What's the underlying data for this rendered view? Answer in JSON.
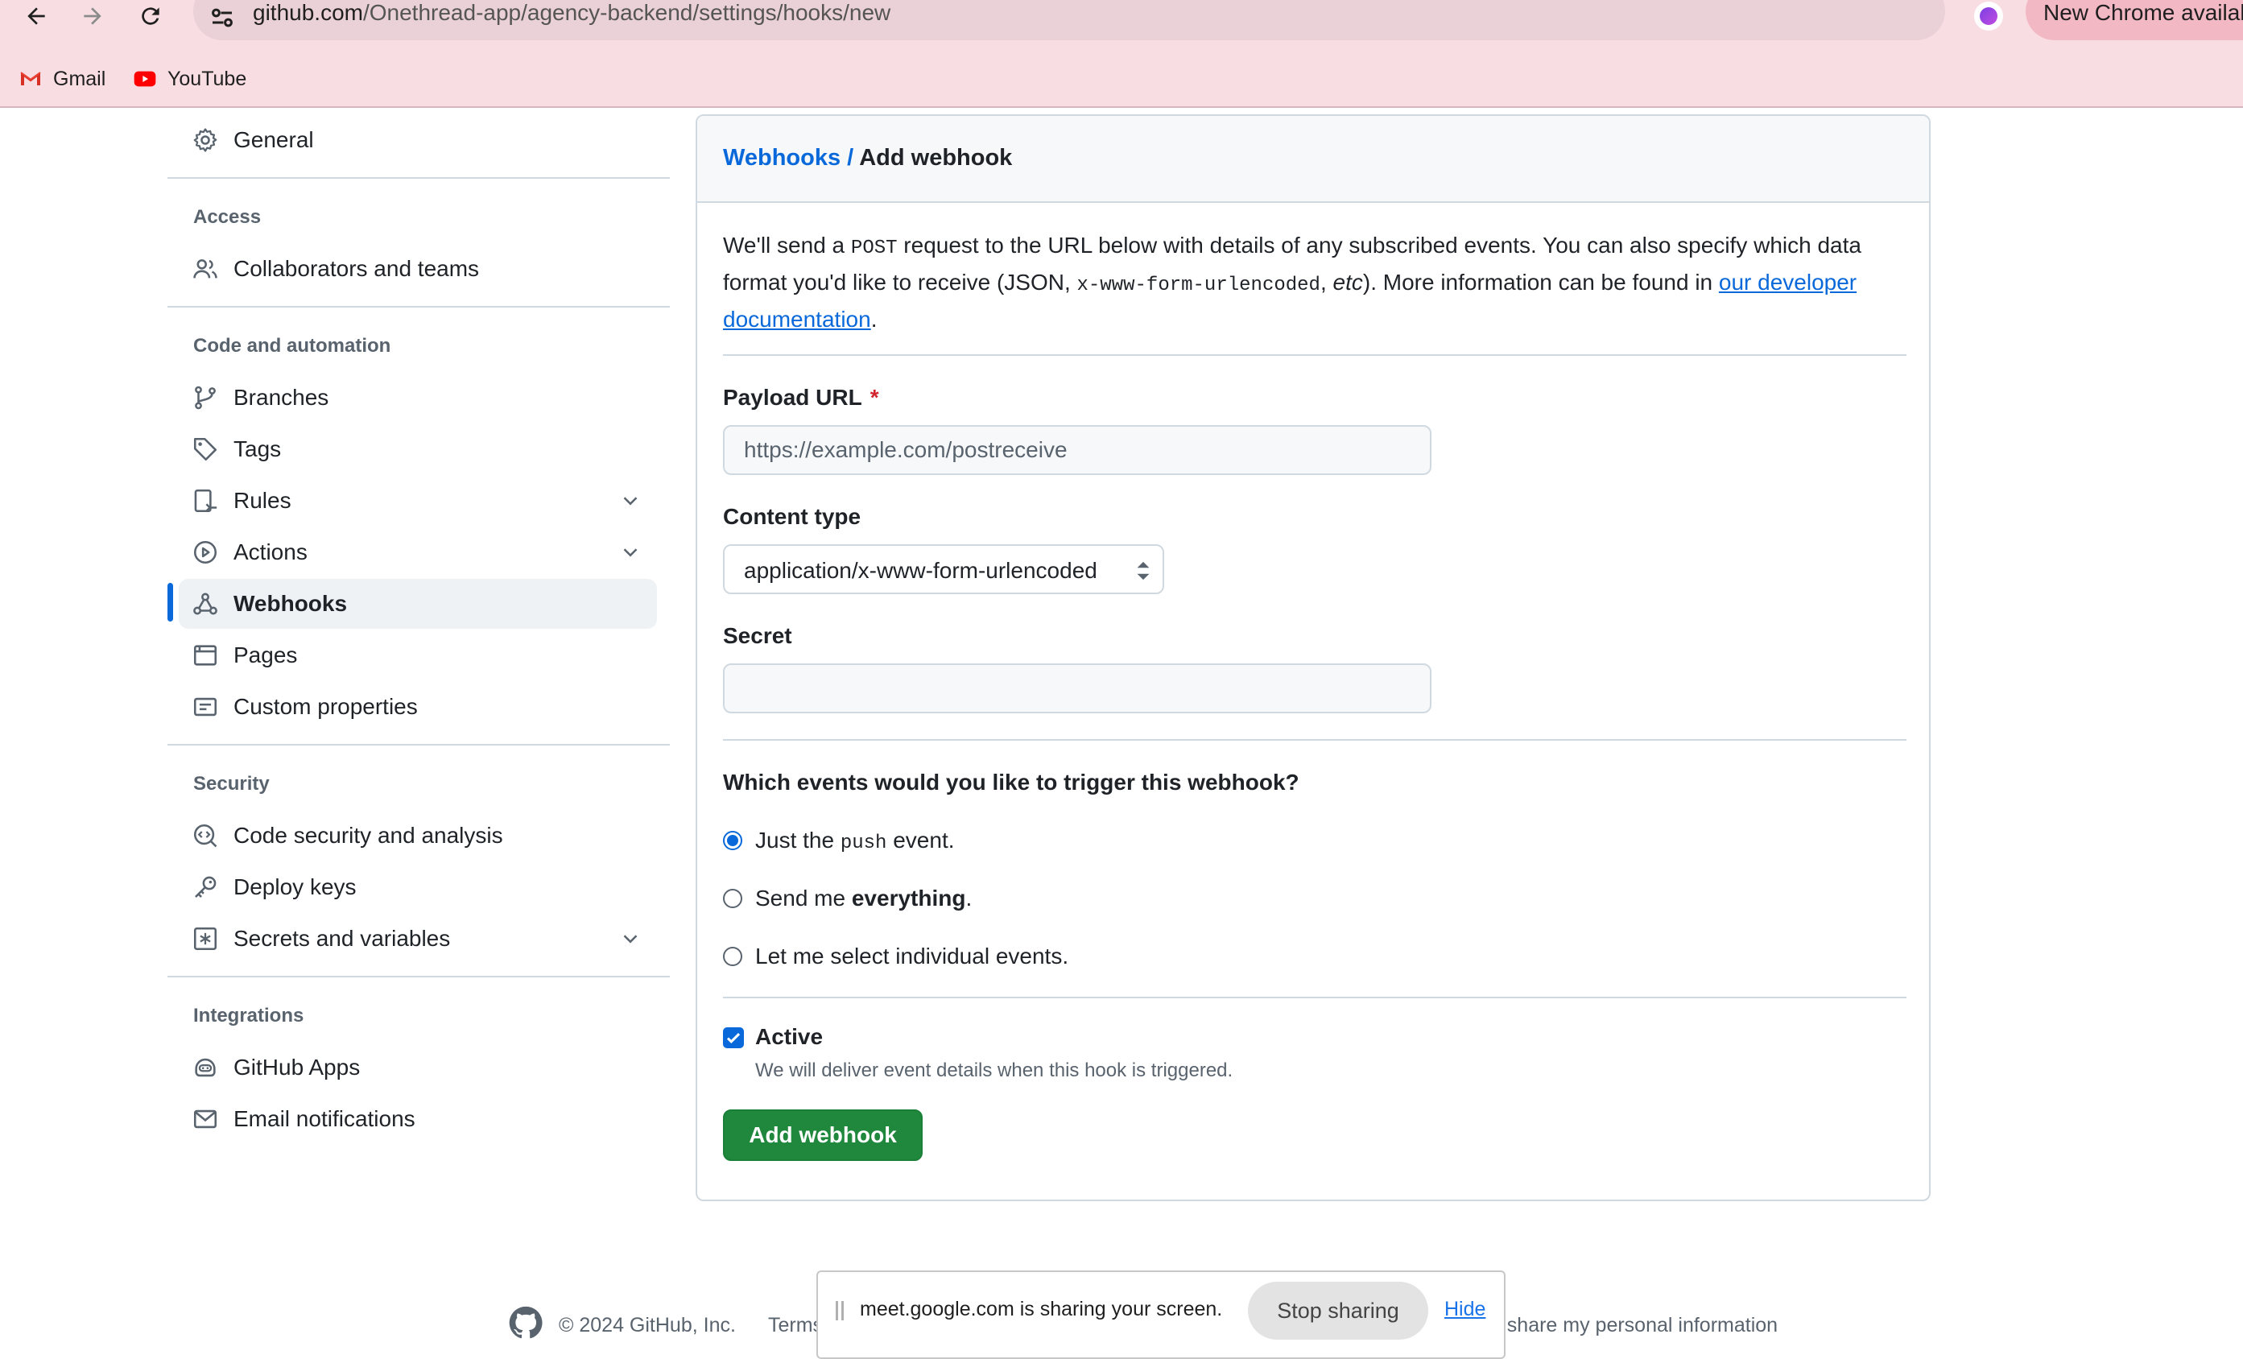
{
  "browser": {
    "url_host": "github.com",
    "url_path": "/Onethread-app/agency-backend/settings/hooks/new",
    "update_chip": "New Chrome availab",
    "bookmarks": [
      {
        "label": "Gmail",
        "icon": "gmail-icon"
      },
      {
        "label": "YouTube",
        "icon": "youtube-icon"
      }
    ]
  },
  "sidebar": {
    "general": "General",
    "sections": {
      "access": "Access",
      "code": "Code and automation",
      "security": "Security",
      "integrations": "Integrations"
    },
    "items": {
      "collaborators": "Collaborators and teams",
      "branches": "Branches",
      "tags": "Tags",
      "rules": "Rules",
      "actions": "Actions",
      "webhooks": "Webhooks",
      "pages": "Pages",
      "custom_properties": "Custom properties",
      "code_security": "Code security and analysis",
      "deploy_keys": "Deploy keys",
      "secrets": "Secrets and variables",
      "github_apps": "GitHub Apps",
      "email_notifications": "Email notifications"
    },
    "active_item": "webhooks"
  },
  "main": {
    "breadcrumb_link": "Webhooks",
    "breadcrumb_sep": " / ",
    "breadcrumb_current": "Add webhook",
    "intro": {
      "p1": "We'll send a ",
      "code1": "POST",
      "p2": " request to the URL below with details of any subscribed events. You can also specify which data format you'd like to receive (JSON, ",
      "code2": "x-www-form-urlencoded",
      "p3": ", ",
      "etc": "etc",
      "p4": "). More information can be found in ",
      "link": "our developer documentation",
      "p5": "."
    },
    "payload_label": "Payload URL",
    "payload_required": "*",
    "payload_value": "",
    "payload_placeholder": "https://example.com/postreceive",
    "content_type_label": "Content type",
    "content_type_value": "application/x-www-form-urlencoded",
    "secret_label": "Secret",
    "secret_value": "",
    "events_question": "Which events would you like to trigger this webhook?",
    "events": {
      "push_a": "Just the ",
      "push_code": "push",
      "push_b": " event.",
      "everything_a": "Send me ",
      "everything_b": "everything",
      "everything_c": ".",
      "individual": "Let me select individual events."
    },
    "selected_event": "push",
    "active_label": "Active",
    "active_checked": true,
    "active_note": "We will deliver event details when this hook is triggered.",
    "submit_label": "Add webhook"
  },
  "footer": {
    "copyright": "© 2024 GitHub, Inc.",
    "terms": "Terms",
    "privacy_tail": "ot share my personal information"
  },
  "share_banner": {
    "text": "meet.google.com is sharing your screen.",
    "stop_label": "Stop sharing",
    "hide_label": "Hide"
  },
  "colors": {
    "accent": "#0969da",
    "primary_button": "#1f883d",
    "browser_chrome": "#f8dde3",
    "required": "#d1242f"
  }
}
